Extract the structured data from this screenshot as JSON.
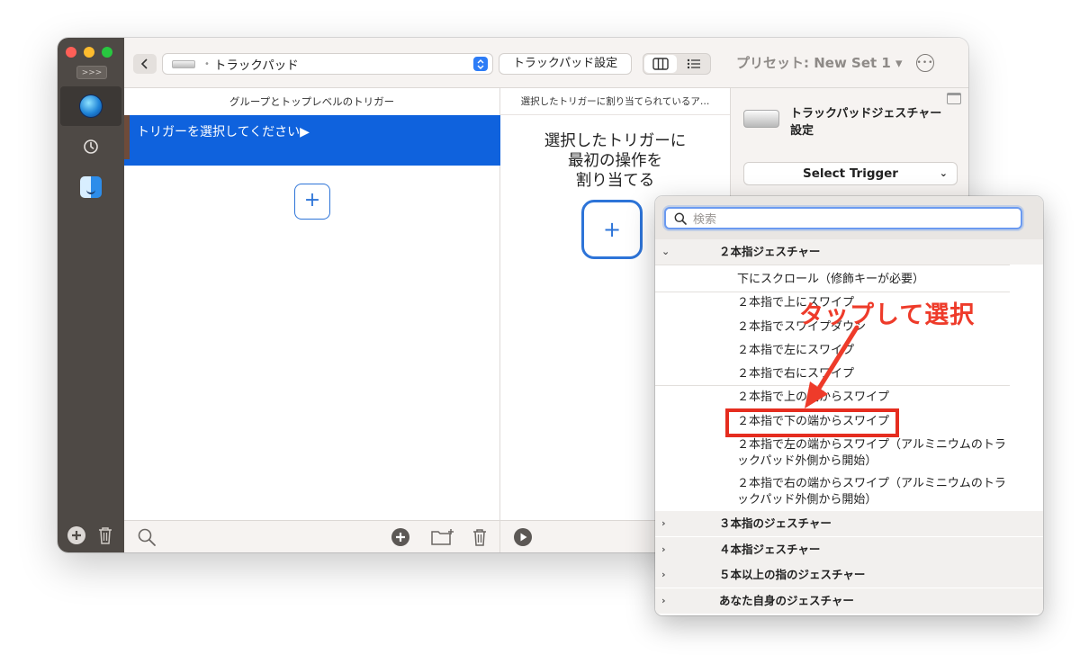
{
  "sidebar": {
    "expand_label": ">>>"
  },
  "toolbar": {
    "device_label": "トラックパッド",
    "pad_settings_label": "トラックパッド設定",
    "preset_label": "プリセット: New Set 1 ▾"
  },
  "columns": {
    "groups_header": "グループとトップレベルのトリガー",
    "select_trigger_prompt": "トリガーを選択してください▶",
    "actions_header": "選択したトリガーに割り当てられているア…",
    "assign_hint_line1": "選択したトリガーに",
    "assign_hint_line2": "最初の操作を",
    "assign_hint_line3": "割り当てる"
  },
  "settings_panel": {
    "title": "トラックパッドジェスチャー設定",
    "trigger_select_label": "Select Trigger"
  },
  "dropdown": {
    "search_placeholder": "検索",
    "groups": [
      {
        "label": "２本指ジェスチャー",
        "expanded": true
      },
      {
        "label": "３本指のジェスチャー",
        "expanded": false
      },
      {
        "label": "４本指ジェスチャー",
        "expanded": false
      },
      {
        "label": "５本以上の指のジェスチャー",
        "expanded": false
      },
      {
        "label": "あなた自身のジェスチャー",
        "expanded": false
      }
    ],
    "items": [
      "下にスクロール（修飾キーが必要）",
      "２本指で上にスワイプ",
      "２本指でスワイプダウン",
      "２本指で左にスワイプ",
      "２本指で右にスワイプ",
      "２本指で上の端からスワイプ",
      "２本指で下の端からスワイプ",
      "２本指で左の端からスワイプ（アルミニウムのトラックパッド外側から開始）",
      "２本指で右の端からスワイプ（アルミニウムのトラックパッド外側から開始）"
    ],
    "highlighted_item": "２本指で下の端からスワイプ"
  },
  "annotation": {
    "text": "タップして選択",
    "color": "#ee3b2a"
  },
  "colors": {
    "accent": "#0f62dd",
    "sidebar": "#4e4945",
    "highlight_box": "#e52d1f"
  }
}
